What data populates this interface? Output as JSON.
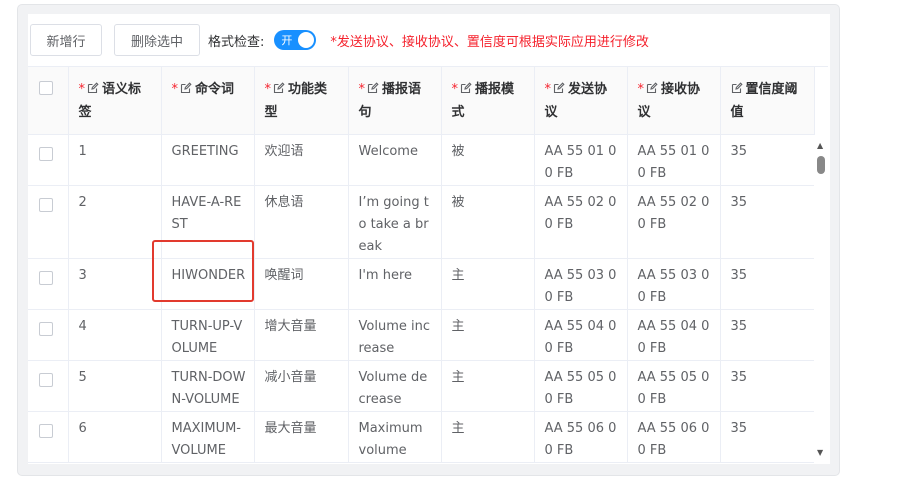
{
  "toolbar": {
    "add_row": "新增行",
    "delete_selected": "删除选中",
    "format_check_label": "格式检查:",
    "switch_text": "开",
    "notice": "*发送协议、接收协议、置信度可根据实际应用进行修改"
  },
  "columns": [
    {
      "label": "语义标签",
      "required": true
    },
    {
      "label": "命令词",
      "required": true
    },
    {
      "label": "功能类型",
      "required": true
    },
    {
      "label": "播报语句",
      "required": true
    },
    {
      "label": "播报模式",
      "required": true
    },
    {
      "label": "发送协议",
      "required": true
    },
    {
      "label": "接收协议",
      "required": true
    },
    {
      "label": "置信度阈值",
      "required": false
    }
  ],
  "rows": [
    {
      "tag": "1",
      "command": "GREETING",
      "func": "欢迎语",
      "speech": "Welcome",
      "mode": "被",
      "send": "AA 55 01 00 FB",
      "recv": "AA 55 01 00 FB",
      "conf": "35"
    },
    {
      "tag": "2",
      "command": "HAVE-A-REST",
      "func": "休息语",
      "speech": "I’m going to take a break",
      "mode": "被",
      "send": "AA 55 02 00 FB",
      "recv": "AA 55 02 00 FB",
      "conf": "35"
    },
    {
      "tag": "3",
      "command": "HIWONDER",
      "func": "唤醒词",
      "speech": "I'm here",
      "mode": "主",
      "send": "AA 55 03 00 FB",
      "recv": "AA 55 03 00 FB",
      "conf": "35"
    },
    {
      "tag": "4",
      "command": "TURN-UP-VOLUME",
      "func": "增大音量",
      "speech": "Volume increase",
      "mode": "主",
      "send": "AA 55 04 00 FB",
      "recv": "AA 55 04 00 FB",
      "conf": "35"
    },
    {
      "tag": "5",
      "command": "TURN-DOWN-VOLUME",
      "func": "减小音量",
      "speech": "Volume decrease",
      "mode": "主",
      "send": "AA 55 05 00 FB",
      "recv": "AA 55 05 00 FB",
      "conf": "35"
    },
    {
      "tag": "6",
      "command": "MAXIMUM-VOLUME",
      "func": "最大音量",
      "speech": "Maximum volume",
      "mode": "主",
      "send": "AA 55 06 00 FB",
      "recv": "AA 55 06 00 FB",
      "conf": "35"
    }
  ],
  "colors": {
    "accent": "#1890ff",
    "danger": "#f5222d",
    "highlight": "#e23a2e"
  },
  "icons": {
    "edit": "edit-icon",
    "scroll_up": "caret-up-icon",
    "scroll_down": "caret-down-icon"
  }
}
